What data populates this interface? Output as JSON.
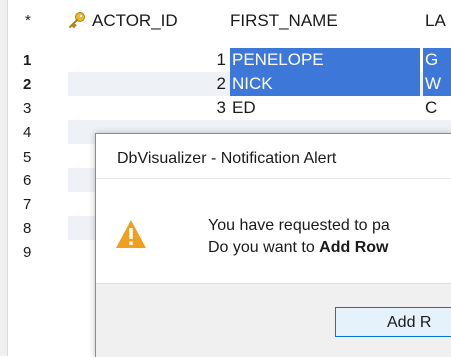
{
  "grid": {
    "header": {
      "star": "*",
      "actor_id": "ACTOR_ID",
      "first_name": "FIRST_NAME",
      "last_name": "LA"
    },
    "rows": [
      {
        "num": "1",
        "actor_id": "1",
        "first_name": "PENELOPE",
        "last_name": "G",
        "selected": true
      },
      {
        "num": "2",
        "actor_id": "2",
        "first_name": "NICK",
        "last_name": "W",
        "selected": true
      },
      {
        "num": "3",
        "actor_id": "3",
        "first_name": "ED",
        "last_name": "C",
        "selected": false
      },
      {
        "num": "4"
      },
      {
        "num": "5"
      },
      {
        "num": "6"
      },
      {
        "num": "7"
      },
      {
        "num": "8"
      },
      {
        "num": "9"
      }
    ]
  },
  "dialog": {
    "title": "DbVisualizer - Notification Alert",
    "message_line1": "You have requested to pa",
    "message_line2_prefix": "Do you want to ",
    "message_line2_bold": "Add Row",
    "button_label": "Add R",
    "icon": "warning-icon"
  },
  "colors": {
    "selection": "#3d78d8",
    "row_stripe": "#eef1f6",
    "warning": "#f0a020",
    "button_border": "#0078d7",
    "button_bg": "#e5f1fb"
  }
}
